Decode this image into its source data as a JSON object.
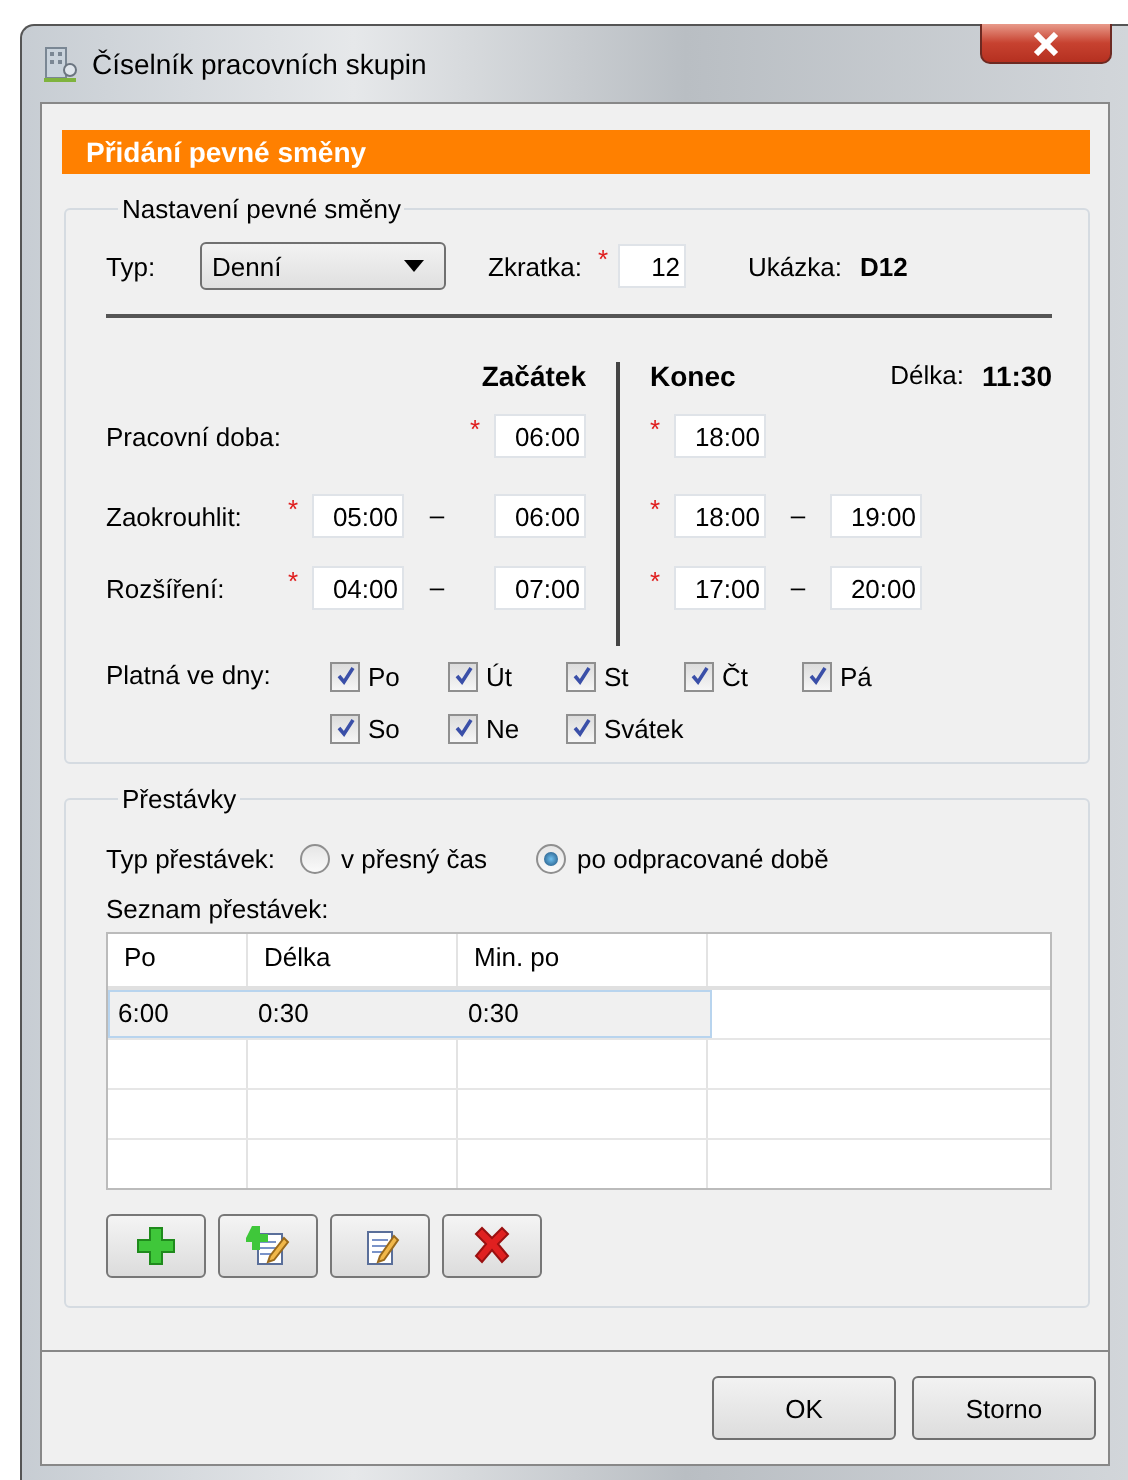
{
  "window": {
    "title": "Číselník pracovních skupin"
  },
  "header": "Přidání pevné směny",
  "shift_group": {
    "title": "Nastavení pevné směny",
    "type": {
      "label": "Typ:",
      "value": "Denní"
    },
    "abbreviation": {
      "label": "Zkratka:",
      "required_mark": "*",
      "value": "12"
    },
    "preview": {
      "label": "Ukázka:",
      "value": "D12"
    },
    "start_heading": "Začátek",
    "end_heading": "Konec",
    "length": {
      "label": "Délka:",
      "value": "11:30"
    },
    "rows": [
      {
        "kind": "single",
        "label": "Pracovní doba:",
        "start_mark": "*",
        "start": [
          "06:00"
        ],
        "end_mark": "*",
        "end": [
          "18:00"
        ]
      },
      {
        "kind": "range",
        "label": "Zaokrouhlit:",
        "start_mark": "*",
        "start": [
          "05:00",
          "06:00"
        ],
        "end_mark": "*",
        "end": [
          "18:00",
          "19:00"
        ],
        "dash": "–"
      },
      {
        "kind": "range",
        "label": "Rozšíření:",
        "start_mark": "*",
        "start": [
          "04:00",
          "07:00"
        ],
        "end_mark": "*",
        "end": [
          "17:00",
          "20:00"
        ],
        "dash": "–"
      }
    ],
    "days_label": "Platná ve dny:",
    "days": [
      {
        "label": "Po",
        "checked": true
      },
      {
        "label": "Út",
        "checked": true
      },
      {
        "label": "St",
        "checked": true
      },
      {
        "label": "Čt",
        "checked": true
      },
      {
        "label": "Pá",
        "checked": true
      },
      {
        "label": "So",
        "checked": true
      },
      {
        "label": "Ne",
        "checked": true
      },
      {
        "label": "Svátek",
        "checked": true
      }
    ]
  },
  "breaks_group": {
    "title": "Přestávky",
    "type_label": "Typ přestávek:",
    "types": [
      {
        "label": "v přesný čas",
        "selected": false
      },
      {
        "label": "po odpracované době",
        "selected": true
      }
    ],
    "list_label": "Seznam přestávek:",
    "table": {
      "columns": [
        "Po",
        "Délka",
        "Min. po"
      ],
      "rows": [
        {
          "cells": [
            "6:00",
            "0:30",
            "0:30"
          ],
          "selected": true
        }
      ]
    },
    "tools": [
      {
        "kind": "add"
      },
      {
        "kind": "add-edit"
      },
      {
        "kind": "edit"
      },
      {
        "kind": "delete"
      }
    ]
  },
  "buttons": [
    "OK",
    "Storno"
  ]
}
